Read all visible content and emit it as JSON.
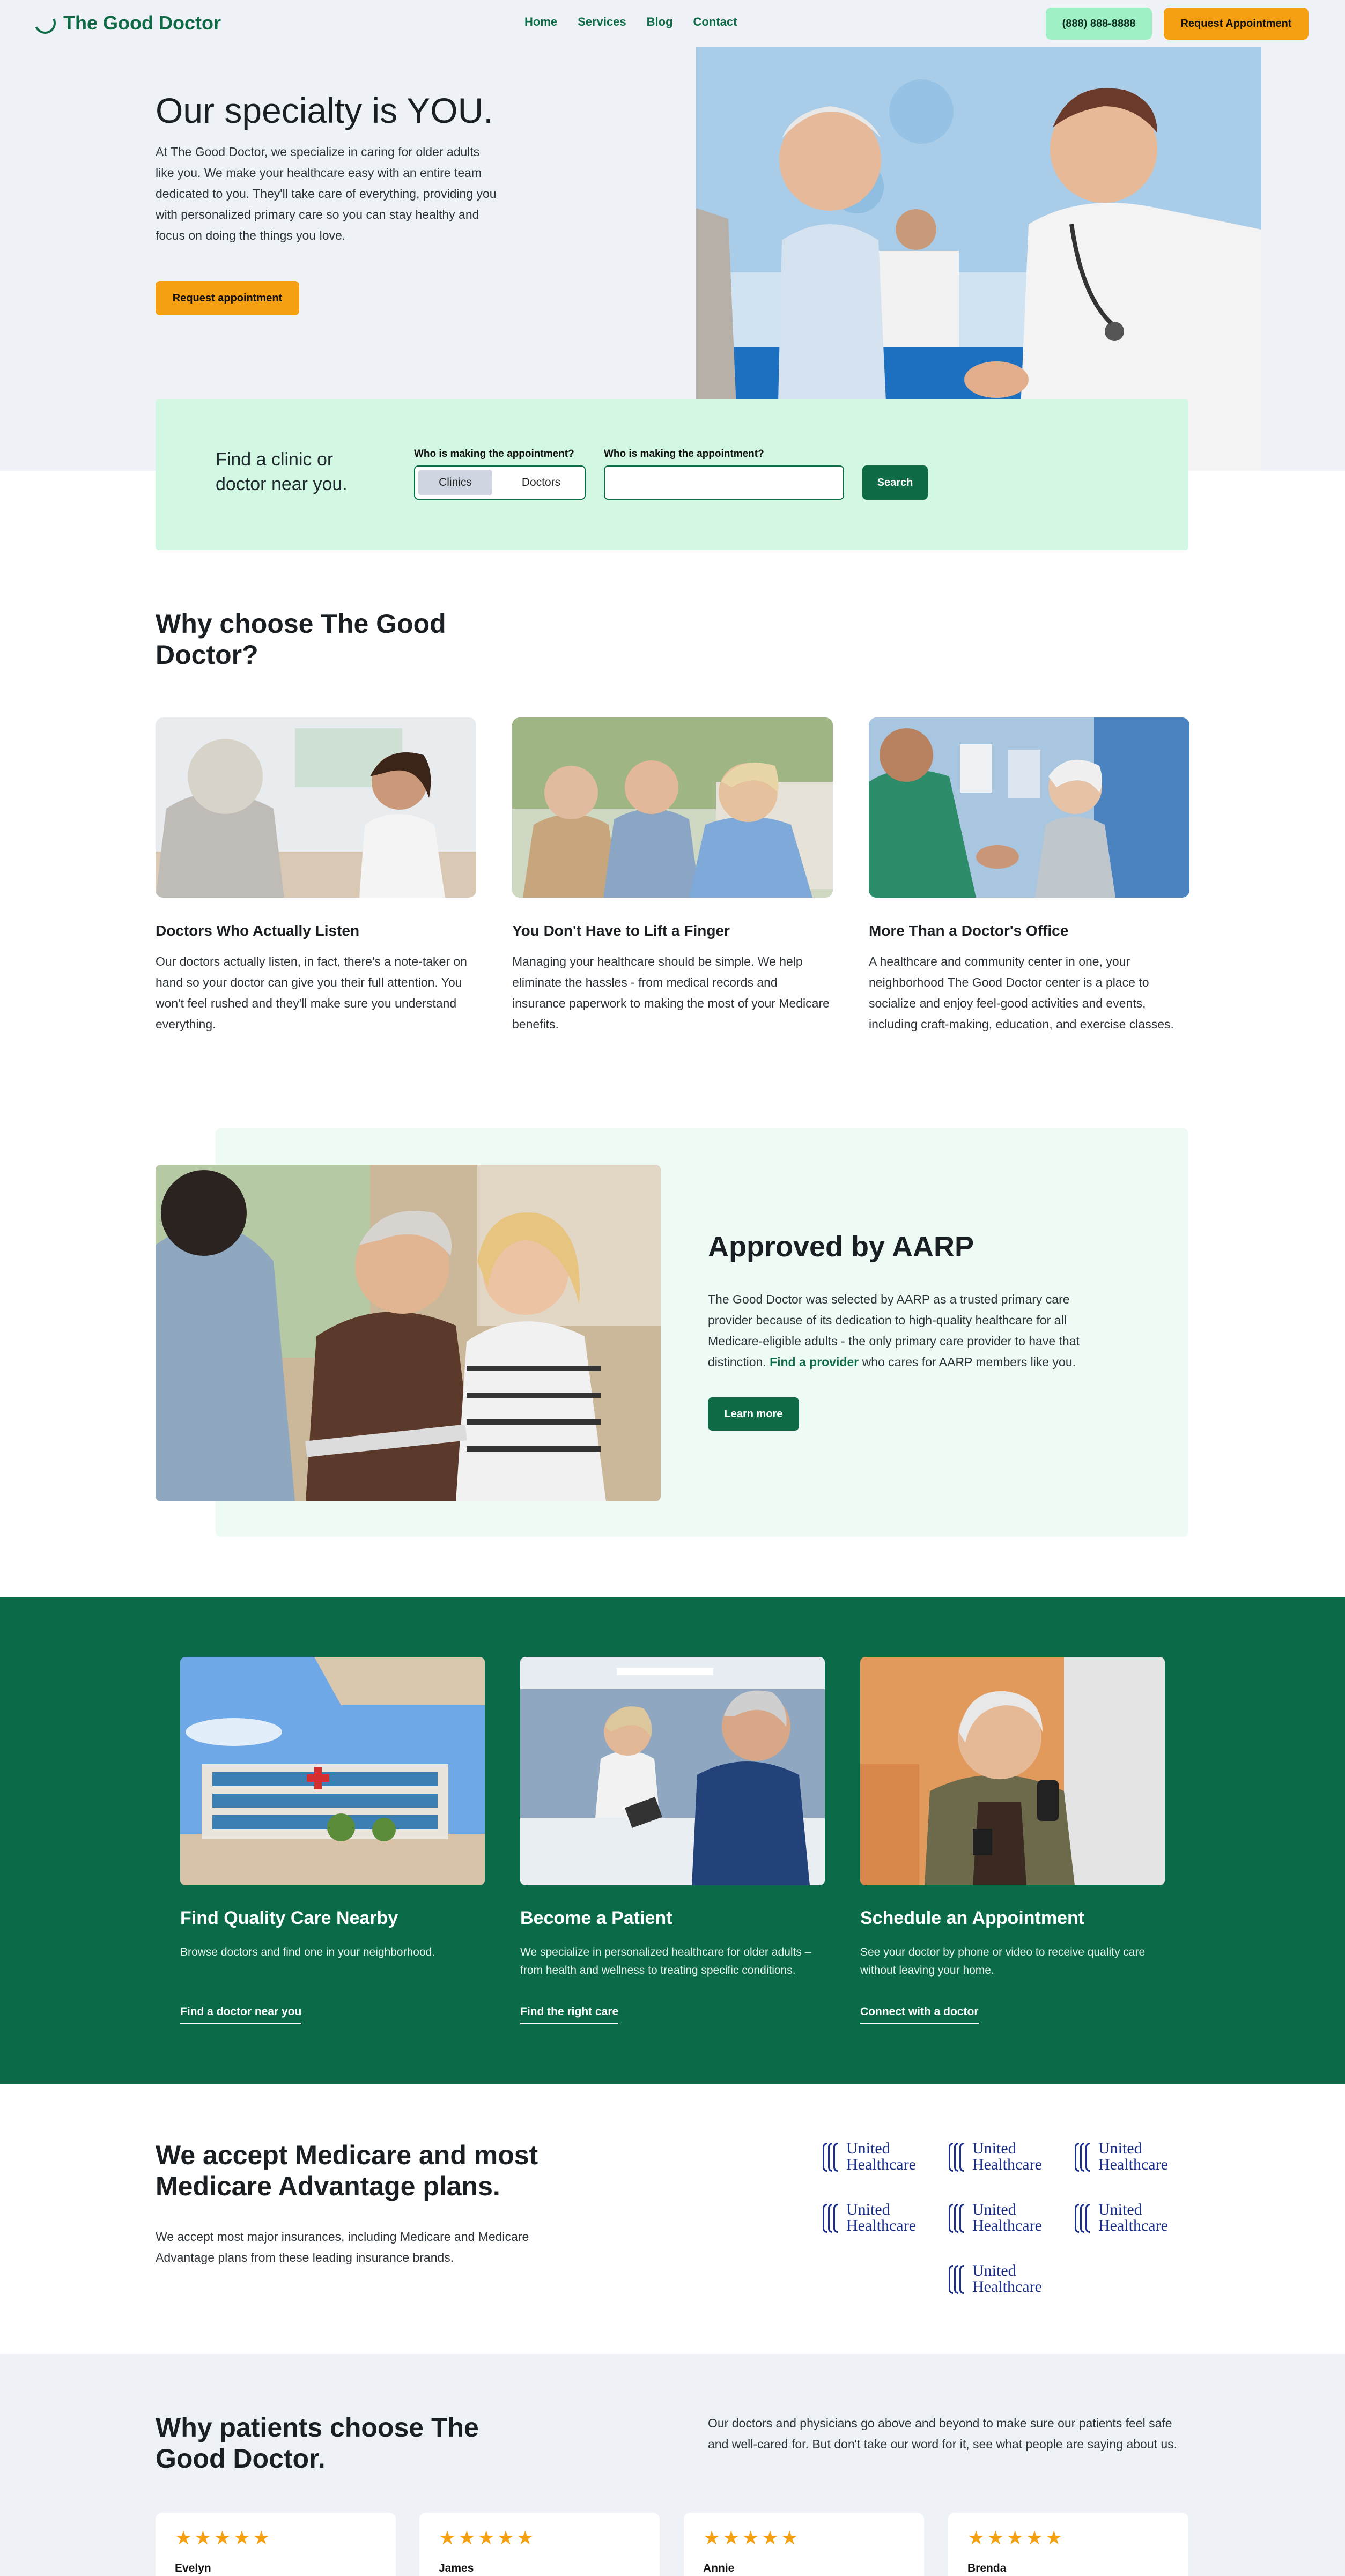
{
  "brand": {
    "name": "The Good Doctor"
  },
  "nav": {
    "items": [
      "Home",
      "Services",
      "Blog",
      "Contact"
    ],
    "phone": "(888) 888-8888",
    "cta": "Request Appointment"
  },
  "hero": {
    "title": "Our specialty is YOU.",
    "text": "At The Good Doctor, we specialize in caring for older adults like you. We make your healthcare easy with an entire team dedicated to you. They'll take care of everything, providing you with personalized primary care so you can stay healthy and focus on doing the things you love.",
    "cta": "Request appointment"
  },
  "search": {
    "title": "Find a clinic or doctor near you.",
    "label_type": "Who is making the appointment?",
    "label_location": "Who is making the appointment?",
    "options": [
      "Clinics",
      "Doctors"
    ],
    "selected": "Clinics",
    "location_value": "",
    "button": "Search"
  },
  "why": {
    "title": "Why choose The Good Doctor?",
    "features": [
      {
        "title": "Doctors Who Actually Listen",
        "text": "Our doctors actually listen, in fact, there's a note-taker on hand so your doctor can give you their full attention. You won't feel rushed and they'll make sure you understand everything."
      },
      {
        "title": "You Don't Have to Lift a Finger",
        "text": "Managing your healthcare should be simple. We help eliminate the hassles - from medical records and insurance paperwork to making the most of your Medicare benefits."
      },
      {
        "title": "More Than a Doctor's Office",
        "text": "A healthcare and community center in one, your neighborhood The Good Doctor center is a place to socialize and enjoy feel-good activities and events, including craft-making, education, and exercise classes."
      }
    ]
  },
  "aarp": {
    "title": "Approved by AARP",
    "text_before": "The Good Doctor was selected by AARP as a trusted primary care provider because of its dedication to high-quality healthcare for all Medicare-eligible adults - the only primary care provider to have that distinction. ",
    "link": "Find a provider",
    "text_after": " who cares for AARP members like you.",
    "button": "Learn more"
  },
  "services": [
    {
      "title": "Find Quality Care Nearby",
      "text": "Browse doctors and find one in your neighborhood.",
      "link": "Find a doctor near you"
    },
    {
      "title": "Become a Patient",
      "text": "We specialize in personalized healthcare for older adults – from health and wellness to treating specific conditions.",
      "link": "Find the right care"
    },
    {
      "title": "Schedule an Appointment",
      "text": "See your doctor by phone or video to receive quality care without leaving your home.",
      "link": "Connect with a doctor"
    }
  ],
  "insurance": {
    "title": "We accept Medicare and most Medicare Advantage plans.",
    "text": "We accept most major insurances, including Medicare and Medicare Advantage plans from these leading insurance brands.",
    "logo_line1": "United",
    "logo_line2": "Healthcare"
  },
  "testimonials": {
    "title": "Why patients choose The Good Doctor.",
    "text": "Our doctors and physicians go above and beyond to make sure our patients feel safe and well-cared for. But don't take our word for it, see what people are saying about us.",
    "stars": "★★★★★",
    "rating": 5,
    "names": [
      "Evelyn",
      "James",
      "Annie",
      "Brenda"
    ]
  },
  "colors": {
    "brand_green": "#0f6b46",
    "accent_orange": "#f5a012",
    "mint": "#d2f8e4",
    "bg_light": "#eef2f7"
  }
}
